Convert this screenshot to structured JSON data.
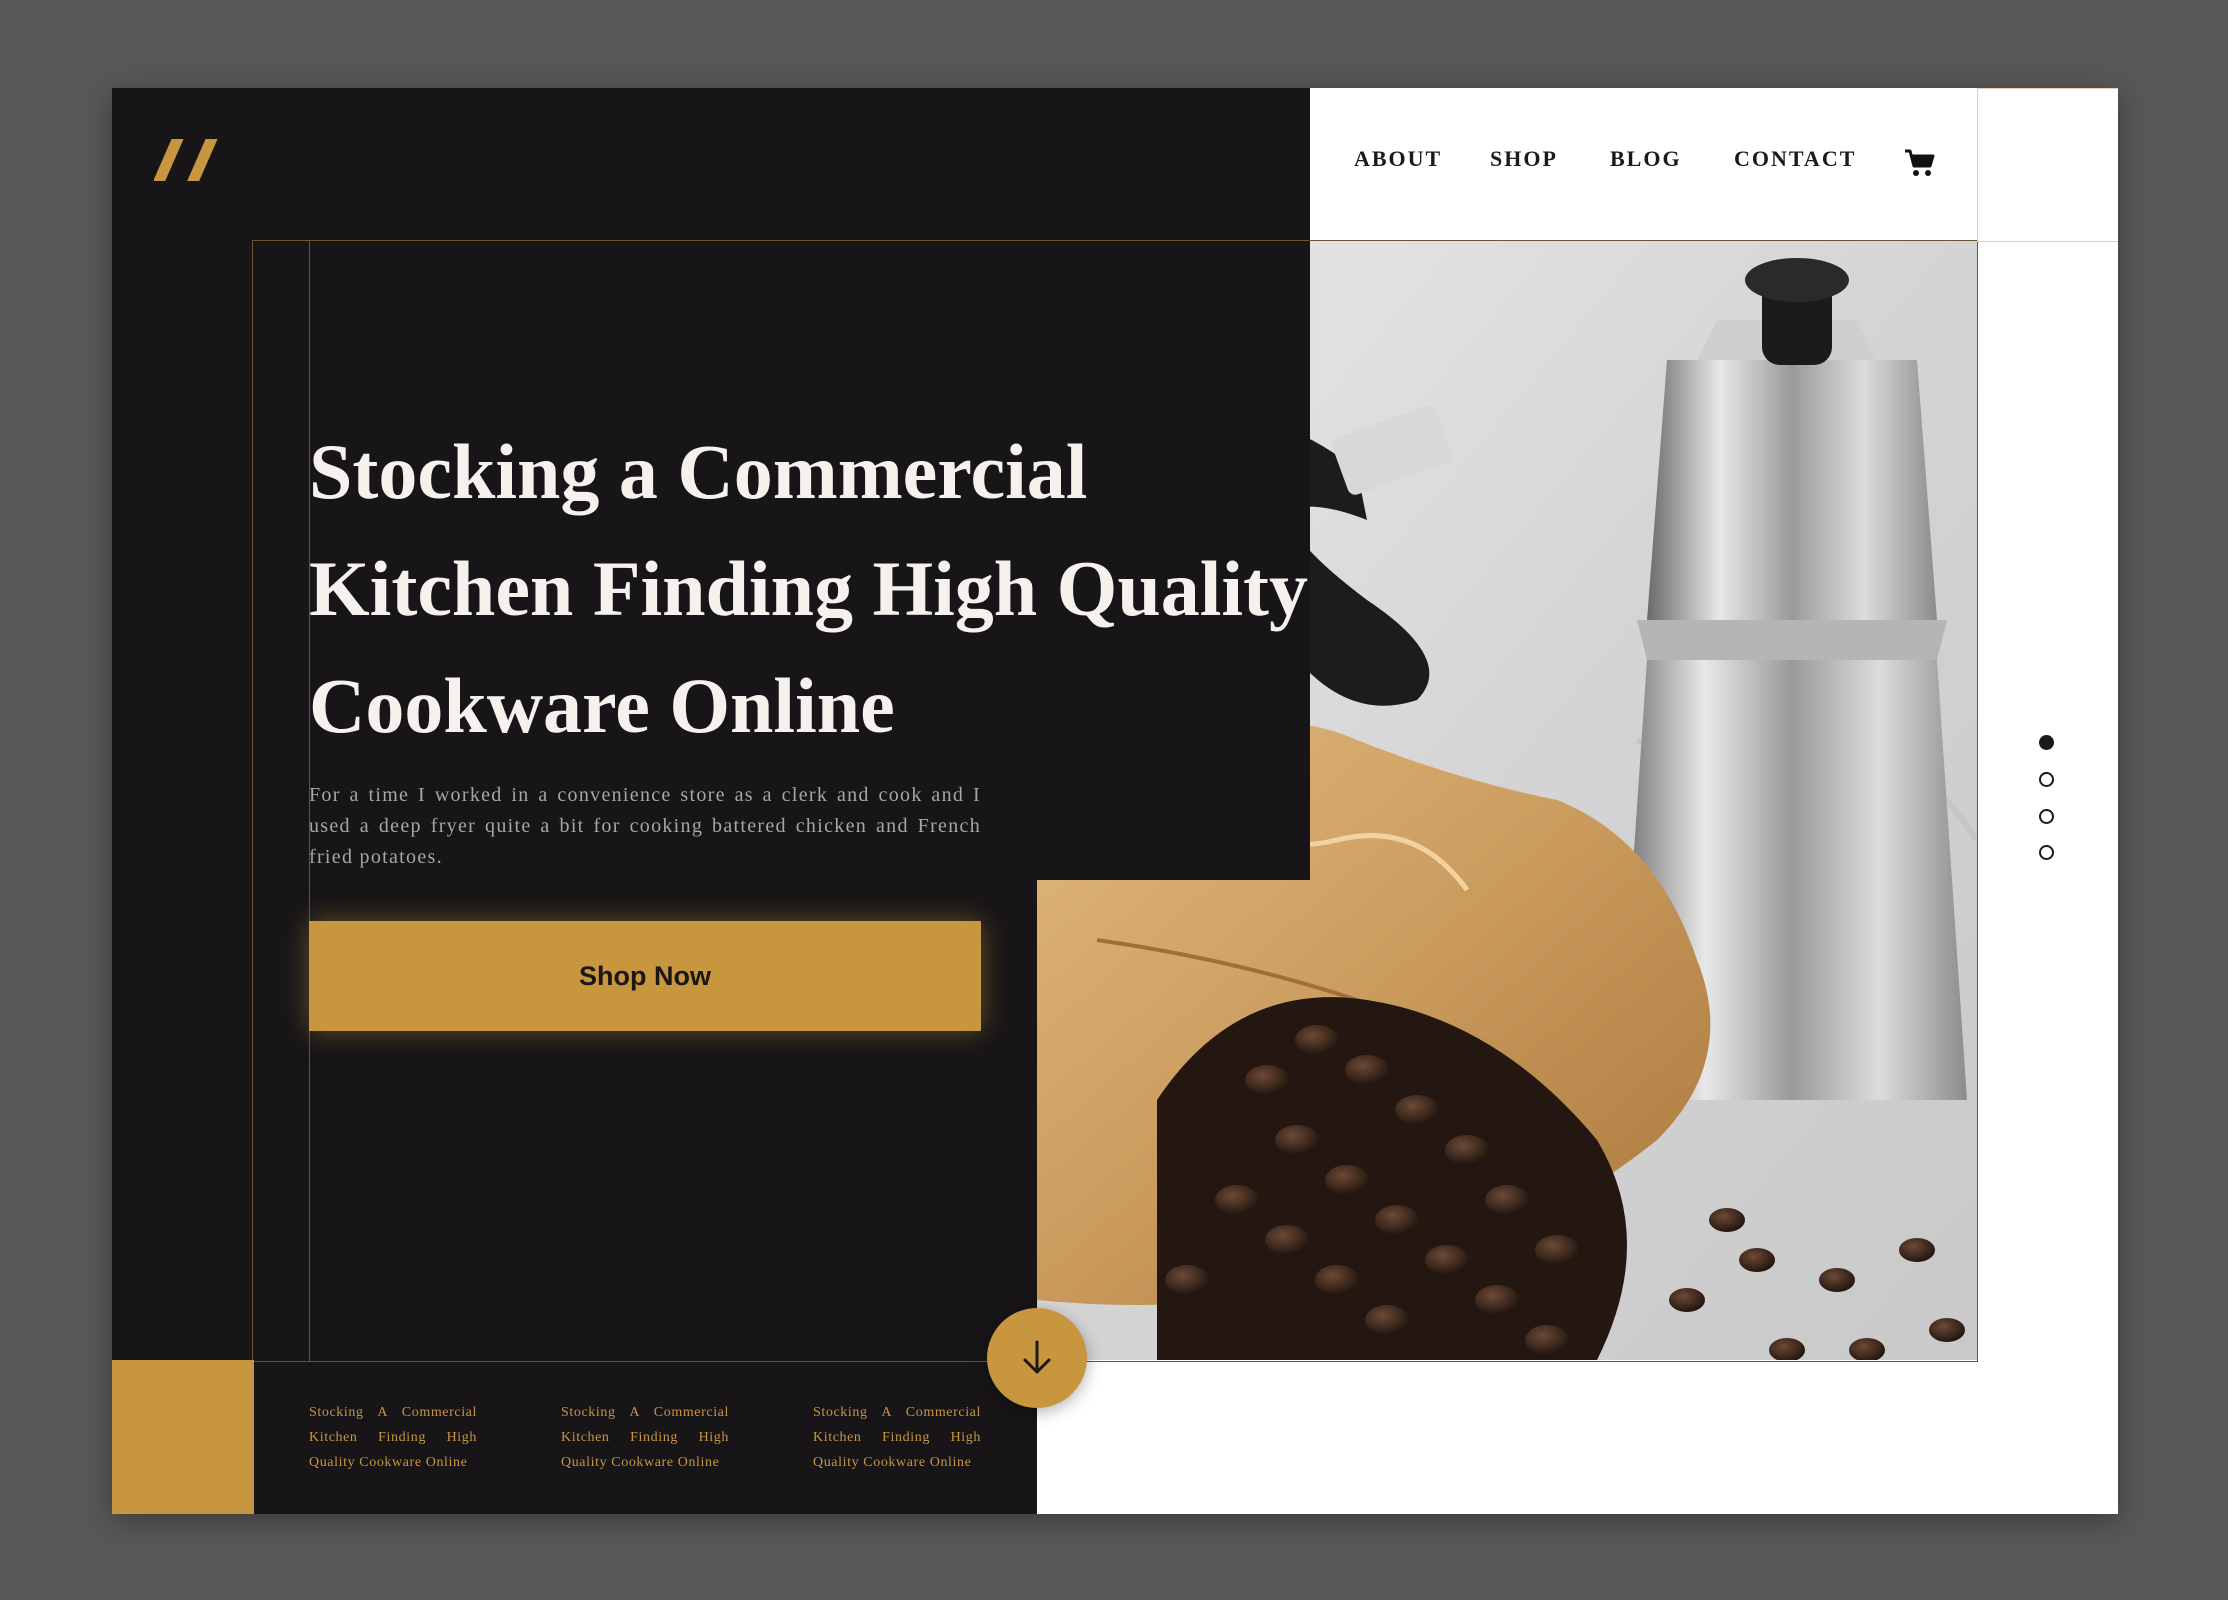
{
  "brand": {
    "logo_icon": "double-slash-logo",
    "accent_color": "#c8963f",
    "dark_color": "#171517"
  },
  "nav": {
    "items": [
      {
        "label": "ABOUT"
      },
      {
        "label": "SHOP"
      },
      {
        "label": "BLOG"
      },
      {
        "label": "CONTACT"
      }
    ],
    "cart_icon": "shopping-cart-icon"
  },
  "hero": {
    "title": "Stocking a Commercial Kitchen Finding High Quality Cookware Online",
    "body": "For a time I worked in a convenience store as a clerk and cook and I used a deep fryer quite a bit for cooking battered chicken and French fried potatoes.",
    "cta_label": "Shop Now",
    "image_icon": "coffee-pot-and-beans-photo"
  },
  "slider": {
    "count": 4,
    "active_index": 0
  },
  "scroll_icon": "arrow-down-icon",
  "footer": {
    "items": [
      {
        "text": "Stocking A Commercial Kitchen Finding High Quality Cookware Online"
      },
      {
        "text": "Stocking A Commercial Kitchen Finding High Quality Cookware Online"
      },
      {
        "text": "Stocking A Commercial Kitchen Finding High Quality Cookware Online"
      }
    ]
  }
}
